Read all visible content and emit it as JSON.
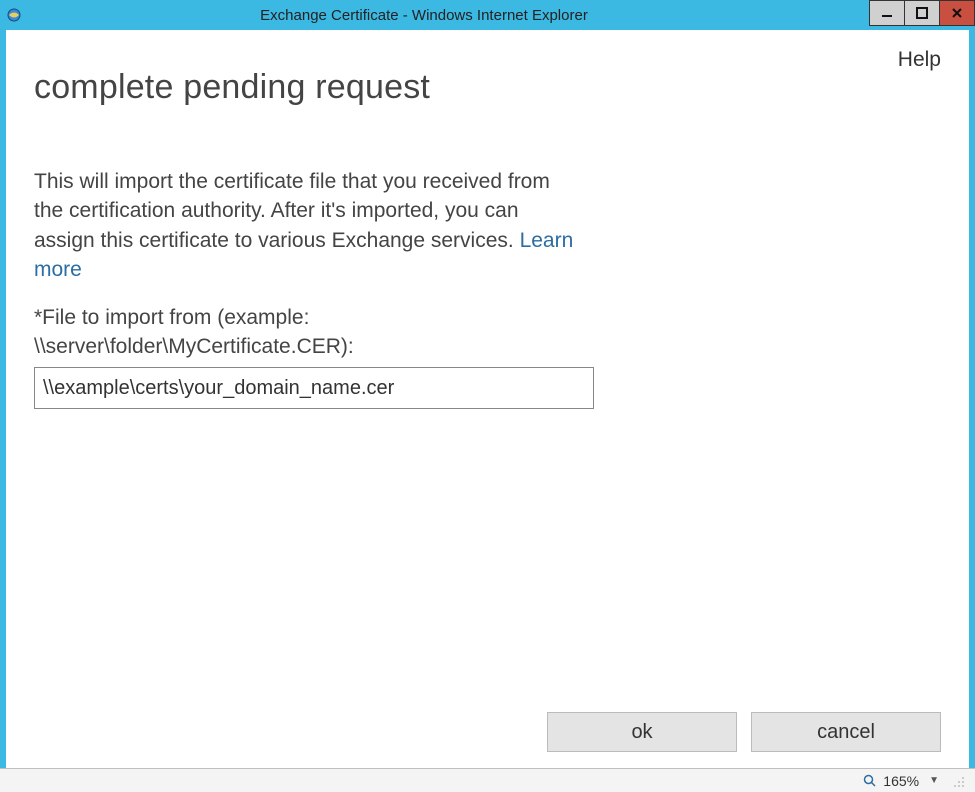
{
  "window": {
    "title": "Exchange Certificate - Windows Internet Explorer"
  },
  "header": {
    "help": "Help",
    "page_title": "complete pending request"
  },
  "body": {
    "description_line1": "This will import the certificate file that you received from the certification authority. After it's imported, you can assign this certificate to various Exchange services. ",
    "learn_more": "Learn more ",
    "field_label_line1": "*File to import from (example:",
    "field_label_line2": "\\\\server\\folder\\MyCertificate.CER):",
    "file_input_value": "\\\\example\\certs\\your_domain_name.cer"
  },
  "buttons": {
    "ok": "ok",
    "cancel": "cancel"
  },
  "statusbar": {
    "zoom": "165%"
  }
}
